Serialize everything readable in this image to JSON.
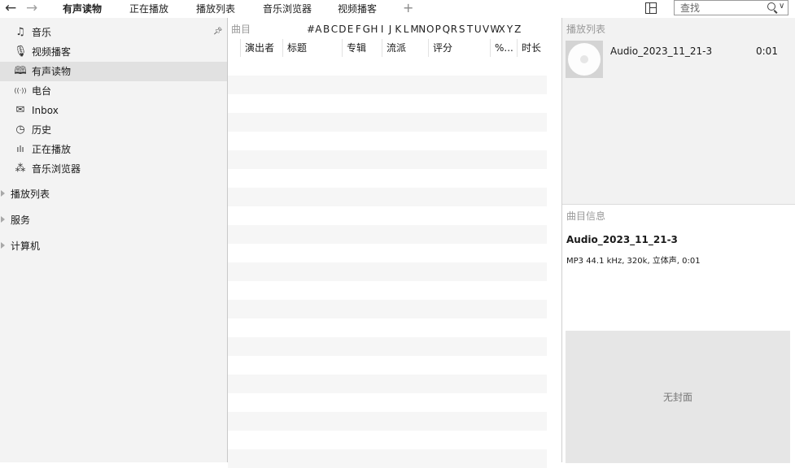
{
  "toolbar": {
    "back_glyph": "←",
    "forward_glyph": "→",
    "tabs": [
      {
        "label": "有声读物",
        "active": true
      },
      {
        "label": "正在播放",
        "active": false
      },
      {
        "label": "播放列表",
        "active": false
      },
      {
        "label": "音乐浏览器",
        "active": false
      },
      {
        "label": "视频播客",
        "active": false
      }
    ],
    "add_tab_glyph": "+",
    "search": {
      "placeholder": "查找",
      "value": ""
    }
  },
  "sidebar": {
    "items": [
      {
        "label": "音乐",
        "icon": "music-note-icon",
        "glyph": "♫",
        "active": false
      },
      {
        "label": "视频播客",
        "icon": "microphone-icon",
        "glyph": "🎙",
        "active": false
      },
      {
        "label": "有声读物",
        "icon": "book-icon",
        "glyph": "🕮",
        "active": true
      },
      {
        "label": "电台",
        "icon": "radio-icon",
        "glyph": "((·))",
        "active": false
      },
      {
        "label": "Inbox",
        "icon": "mail-icon",
        "glyph": "✉",
        "active": false
      },
      {
        "label": "历史",
        "icon": "clock-icon",
        "glyph": "◷",
        "active": false
      },
      {
        "label": "正在播放",
        "icon": "equalizer-icon",
        "glyph": "ılı",
        "active": false
      },
      {
        "label": "音乐浏览器",
        "icon": "browser-nodes-icon",
        "glyph": "⁂",
        "active": false
      }
    ],
    "groups": [
      "播放列表",
      "服务",
      "计算机"
    ]
  },
  "main": {
    "track_count_label": "曲目",
    "alpha_index": [
      "#",
      "A",
      "B",
      "C",
      "D",
      "E",
      "F",
      "G",
      "H",
      "I",
      "J",
      "K",
      "L",
      "M",
      "N",
      "O",
      "P",
      "Q",
      "R",
      "S",
      "T",
      "U",
      "V",
      "W",
      "X",
      "Y",
      "Z"
    ],
    "columns": [
      "演出者",
      "标题",
      "专辑",
      "流派",
      "评分",
      "%...",
      "时长"
    ]
  },
  "right": {
    "playlist_title": "播放列表",
    "playlist_item": {
      "name": "Audio_2023_11_21-3",
      "duration": "0:01"
    },
    "info_title": "曲目信息",
    "track_title": "Audio_2023_11_21-3",
    "track_meta": "MP3 44.1 kHz, 320k, 立体声, 0:01",
    "no_cover_label": "无封面"
  }
}
